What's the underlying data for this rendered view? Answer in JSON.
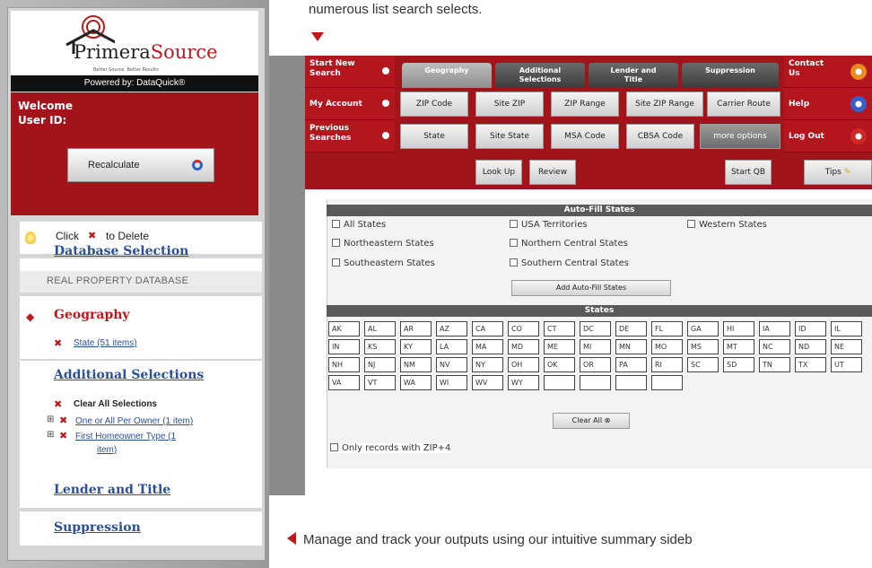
{
  "captions": {
    "top": "numerous list search selects.",
    "bottom": "Manage and track your outputs using our intuitive summary sideb"
  },
  "brand": {
    "logo_primary": "Primera",
    "logo_secondary": "Source",
    "tagline": "Better Source. Better Results",
    "powered_by": "Powered by: DataQuick®"
  },
  "colors": {
    "accent": "#a3141a",
    "link": "#2a4f9c",
    "dark_bar": "#111111"
  },
  "sidebar": {
    "welcome": "Welcome",
    "user_id": "User ID:",
    "recalculate": "Recalculate",
    "hint_click": "Click",
    "hint_delete": "to Delete",
    "database_selection": "Database Selection",
    "database_name": "REAL PROPERTY DATABASE",
    "geography": "Geography",
    "geography_item": "State (51 items)",
    "additional_selections": "Additional Selections",
    "clear_all": "Clear All Selections",
    "addl_item_1": "One or All Per Owner (1 item)",
    "addl_item_2a": "First Homeowner Type (1",
    "addl_item_2b": "item)",
    "lender_title": "Lender and Title",
    "suppression": "Suppression"
  },
  "nav": {
    "start_new_search": [
      "Start New",
      "Search"
    ],
    "my_account": "My Account",
    "previous_searches": [
      "Previous",
      "Searches"
    ],
    "tabs": [
      {
        "label": [
          "Geography"
        ]
      },
      {
        "label": [
          "Additional",
          "Selections"
        ]
      },
      {
        "label": [
          "Lender and",
          "Title"
        ]
      },
      {
        "label": [
          "Suppression"
        ]
      }
    ],
    "row2_buttons": [
      "ZIP Code",
      "Site ZIP",
      "ZIP Range",
      "Site ZIP Range",
      "Carrier Route"
    ],
    "row3_buttons": [
      "State",
      "Site State",
      "MSA Code",
      "CBSA Code",
      "more options"
    ],
    "contact_us": [
      "Contact",
      "Us"
    ],
    "help": "Help",
    "log_out": "Log Out",
    "look_up": "Look Up",
    "review": "Review",
    "start_qb": "Start QB",
    "tips": "Tips"
  },
  "auto_fill": {
    "header": "Auto-Fill States",
    "options": [
      "All States",
      "USA Territories",
      "Western States",
      "Northeastern States",
      "Northern Central States",
      "Southeastern States",
      "Southern Central States"
    ],
    "add_button": "Add Auto-Fill States"
  },
  "states": {
    "header": "States",
    "values": [
      "AK",
      "AL",
      "AR",
      "AZ",
      "CA",
      "CO",
      "CT",
      "DC",
      "DE",
      "FL",
      "GA",
      "HI",
      "IA",
      "ID",
      "IL",
      "IN",
      "KS",
      "KY",
      "LA",
      "MA",
      "MD",
      "ME",
      "MI",
      "MN",
      "MO",
      "MS",
      "MT",
      "NC",
      "ND",
      "NE",
      "NH",
      "NJ",
      "NM",
      "NV",
      "NY",
      "OH",
      "OK",
      "OR",
      "PA",
      "RI",
      "SC",
      "SD",
      "TN",
      "TX",
      "UT",
      "VA",
      "VT",
      "WA",
      "WI",
      "WV",
      "WY",
      "",
      "",
      "",
      ""
    ],
    "clear_all": "Clear All",
    "zip4_option": "Only records with ZIP+4"
  }
}
